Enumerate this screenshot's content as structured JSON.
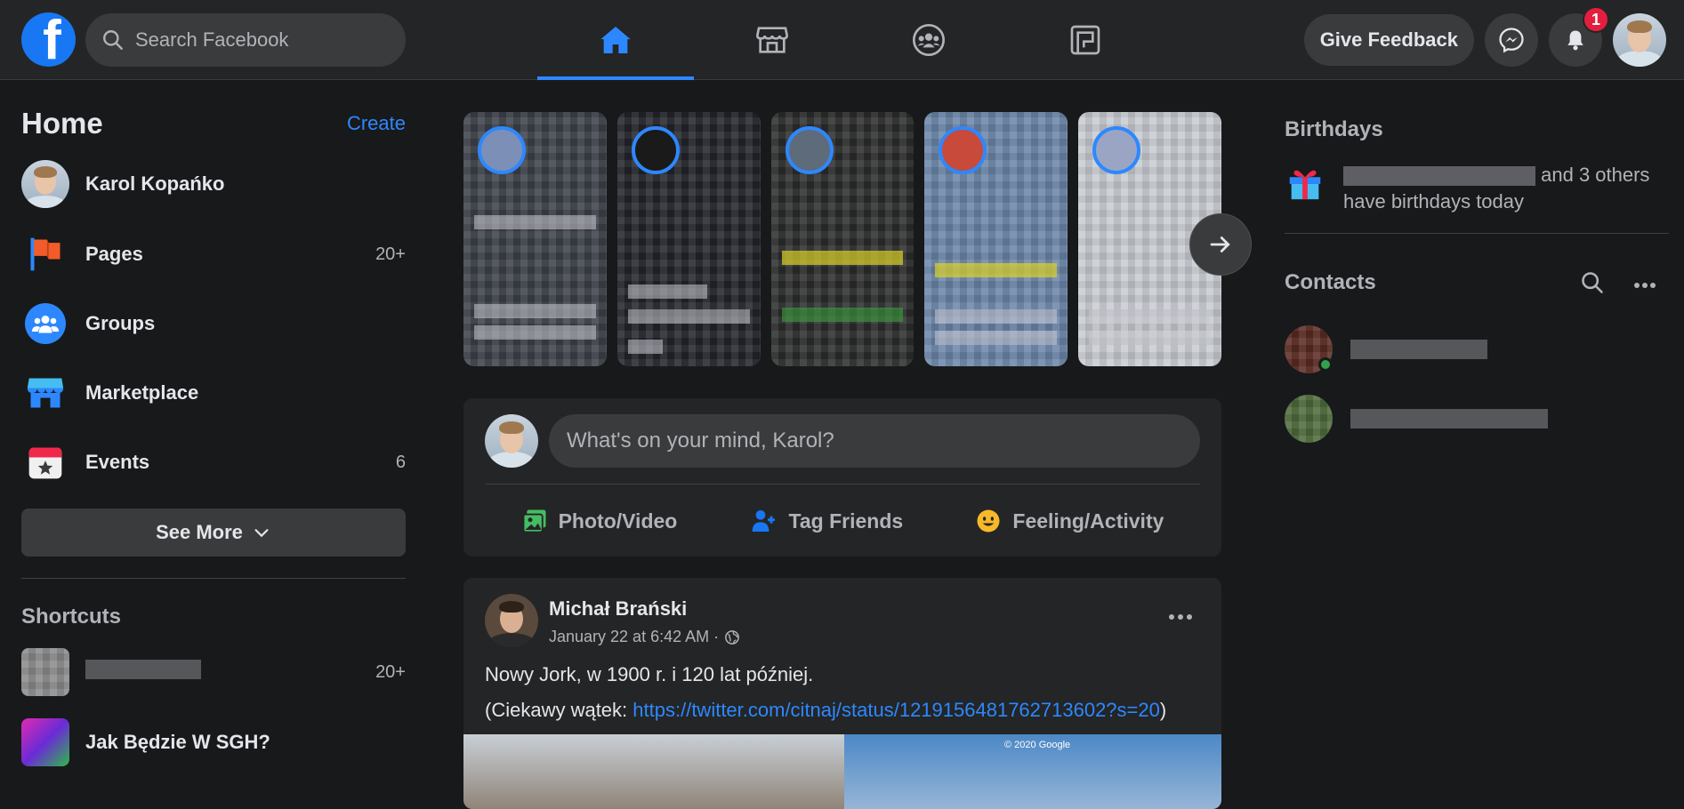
{
  "header": {
    "logo_letter": "f",
    "search_placeholder": "Search Facebook",
    "nav_tabs": [
      {
        "name": "home",
        "icon": "home-icon",
        "active": true
      },
      {
        "name": "marketplace",
        "icon": "marketplace-icon",
        "active": false
      },
      {
        "name": "groups",
        "icon": "groups-icon",
        "active": false
      },
      {
        "name": "gaming",
        "icon": "gaming-icon",
        "active": false
      }
    ],
    "feedback_label": "Give Feedback",
    "notification_count": "1"
  },
  "left": {
    "title": "Home",
    "create_label": "Create",
    "items": [
      {
        "label": "Karol Kopańko",
        "count": ""
      },
      {
        "label": "Pages",
        "count": "20+"
      },
      {
        "label": "Groups",
        "count": ""
      },
      {
        "label": "Marketplace",
        "count": ""
      },
      {
        "label": "Events",
        "count": "6"
      }
    ],
    "see_more_label": "See More",
    "shortcuts_title": "Shortcuts",
    "shortcuts": [
      {
        "label": "",
        "count": "20+"
      },
      {
        "label": "Jak Będzie W SGH?",
        "count": ""
      }
    ]
  },
  "composer": {
    "placeholder": "What's on your mind, Karol?",
    "actions": [
      {
        "label": "Photo/Video",
        "icon": "photo-video-icon"
      },
      {
        "label": "Tag Friends",
        "icon": "tag-friends-icon"
      },
      {
        "label": "Feeling/Activity",
        "icon": "feeling-icon"
      }
    ]
  },
  "post": {
    "author": "Michał Brański",
    "time": "January 22 at 6:42 AM ·",
    "text1": "Nowy Jork, w 1900 r. i 120 lat później.",
    "text2_prefix": "(Ciekawy wątek: ",
    "link": "https://twitter.com/citnaj/status/1219156481762713602?s=20",
    "text2_suffix": ")",
    "image_credit": "© 2020 Google"
  },
  "right": {
    "birthdays_title": "Birthdays",
    "birthday_suffix": "and 3 others",
    "birthday_line2": "have birthdays today",
    "contacts_title": "Contacts"
  },
  "colors": {
    "accent": "#2d88ff",
    "background": "#18191a",
    "surface": "#242526",
    "badge": "#e41e3f",
    "online": "#31a24c"
  }
}
